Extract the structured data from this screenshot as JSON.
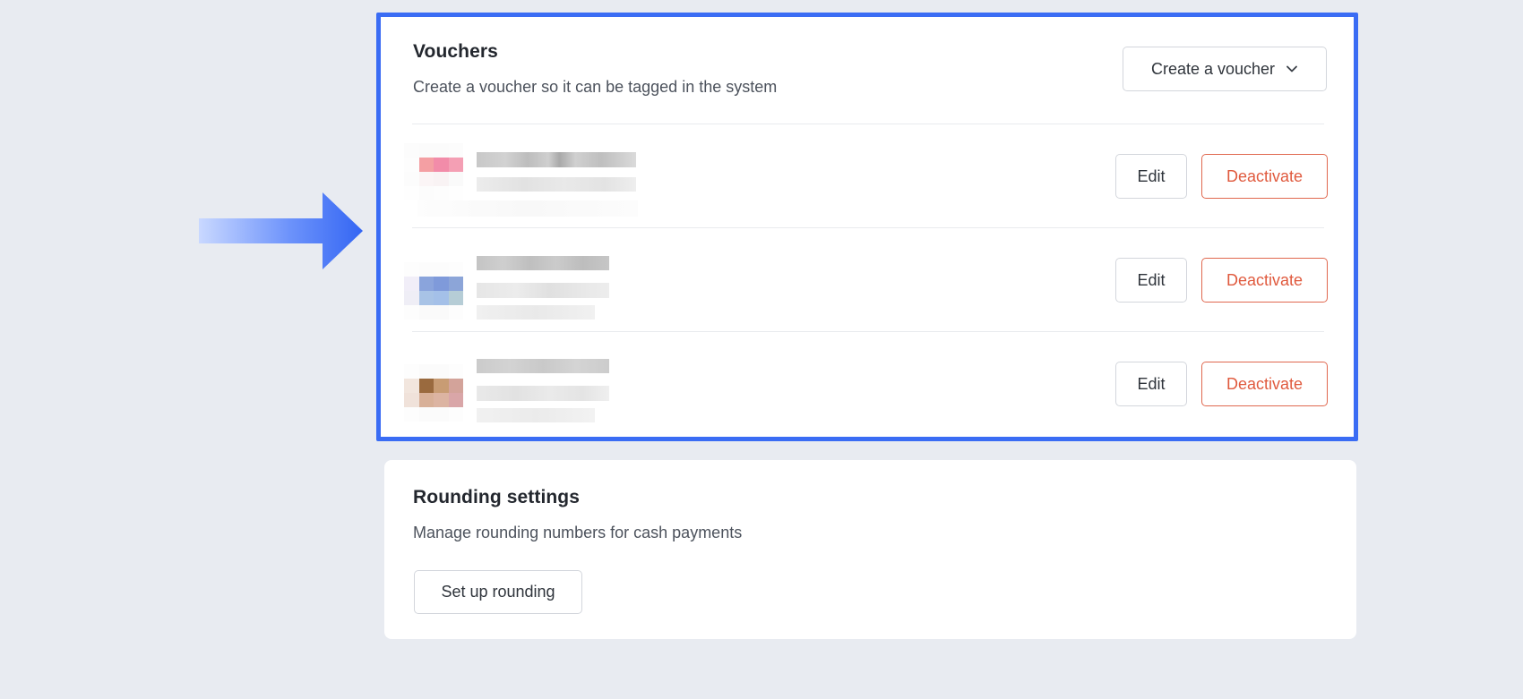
{
  "vouchers": {
    "title": "Vouchers",
    "subtitle": "Create a voucher so it can be tagged in the system",
    "create_label": "Create a voucher",
    "items": [
      {
        "edit_label": "Edit",
        "deactivate_label": "Deactivate",
        "thumb": [
          "#fcfcfc",
          "#fbfbfb",
          "#fbfbfb",
          "#fcfcfc",
          "#fdfdfd",
          "#f49fa3",
          "#f28ca9",
          "#f49fb4",
          "#fcfcfc",
          "#fbf5f6",
          "#f9f3f4",
          "#fafafa",
          "#fefefe",
          "#fcfcfc",
          "#fdfdfd",
          "#fefefe"
        ]
      },
      {
        "edit_label": "Edit",
        "deactivate_label": "Deactivate",
        "thumb": [
          "#fdfdfd",
          "#fcfcfc",
          "#fcfcfc",
          "#fdfdfd",
          "#f1eef8",
          "#8aa4dc",
          "#7f9ada",
          "#8ca5d8",
          "#efeef6",
          "#a8c3e6",
          "#a4c0e8",
          "#b6cdd6",
          "#fdfdfd",
          "#fafafa",
          "#fafafa",
          "#fdfdfd"
        ]
      },
      {
        "edit_label": "Edit",
        "deactivate_label": "Deactivate",
        "thumb": [
          "#fdfdfd",
          "#fbfbfb",
          "#fbfbfb",
          "#fdfdfd",
          "#f2e6de",
          "#9a6a3e",
          "#c89c74",
          "#d3a39a",
          "#f0e2da",
          "#d8b098",
          "#dcb4a2",
          "#d9a6a8",
          "#fdfdfd",
          "#fbfbfb",
          "#fbfbfb",
          "#fdfdfd"
        ]
      }
    ]
  },
  "rounding": {
    "title": "Rounding settings",
    "subtitle": "Manage rounding numbers for cash payments",
    "setup_label": "Set up rounding"
  },
  "colors": {
    "accent_frame": "#3a6cf4",
    "danger": "#e05a3e",
    "page_bg": "#e8ebf1"
  },
  "icons": {
    "pointer": "arrow-right-icon",
    "dropdown": "chevron-down-icon"
  }
}
